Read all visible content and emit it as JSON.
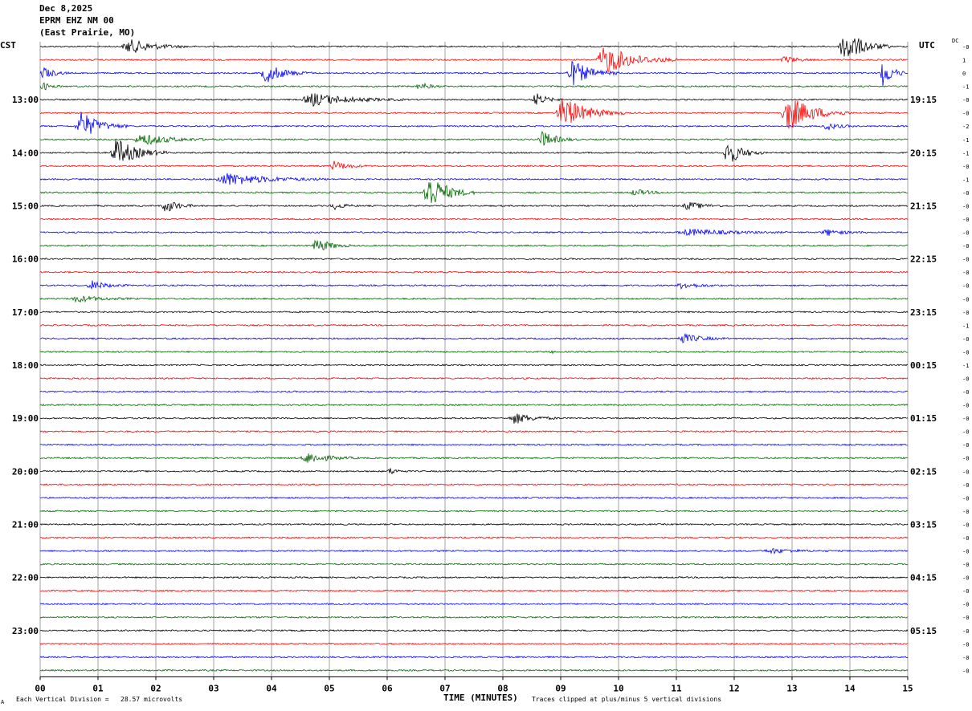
{
  "header": {
    "date": "Dec 8,2025",
    "station": "EPRM EHZ NM 00",
    "location": "(East Prairie, MO)"
  },
  "tz_left": "CST",
  "tz_right": "UTC",
  "dc_label": "DC",
  "footer": {
    "scale": "Each Vertical Division =   28.57 microvolts",
    "clip": "Traces clipped at plus/minus 5 vertical divisions",
    "mark": "A"
  },
  "chart_data": {
    "type": "line",
    "title": "EPRM EHZ NM 00",
    "xlabel": "TIME (MINUTES)",
    "ylabel": "",
    "xlim": [
      0,
      15
    ],
    "x_ticks": [
      "00",
      "01",
      "02",
      "03",
      "04",
      "05",
      "06",
      "07",
      "08",
      "09",
      "10",
      "11",
      "12",
      "13",
      "14",
      "15"
    ],
    "trace_count": 48,
    "trace_minutes": 15,
    "trace_colors": [
      "#000000",
      "#ff0000",
      "#0000ff",
      "#006600"
    ],
    "left_hour_labels": [
      "13:00",
      "14:00",
      "15:00",
      "16:00",
      "17:00",
      "18:00",
      "19:00",
      "20:00",
      "21:00",
      "22:00",
      "23:00"
    ],
    "right_hour_labels": [
      "19:15",
      "20:15",
      "21:15",
      "22:15",
      "23:15",
      "00:15",
      "01:15",
      "02:15",
      "03:15",
      "04:15",
      "05:15"
    ],
    "dc_offsets": [
      "-0",
      "1",
      "0",
      "-1",
      "-0",
      "-0",
      "-2",
      "-1",
      "-1",
      "-0",
      "-1",
      "-0",
      "-0",
      "-0",
      "-0",
      "-0",
      "-0",
      "-0",
      "-0",
      "-0",
      "-0",
      "-1",
      "-0",
      "-0",
      "-1",
      "-0",
      "-0",
      "-0",
      "-0",
      "-0",
      "-0",
      "-0",
      "-0",
      "-0",
      "-0",
      "-0",
      "-0",
      "-0",
      "-0",
      "-0",
      "-0",
      "-0",
      "-0",
      "-0",
      "-0",
      "-0",
      "-0",
      "-0"
    ],
    "events": [
      {
        "trace": 0,
        "minute": 1.4,
        "duration": 1.2,
        "amplitude": 9
      },
      {
        "trace": 0,
        "minute": 13.8,
        "duration": 0.9,
        "amplitude": 22
      },
      {
        "trace": 1,
        "minute": 9.6,
        "duration": 1.4,
        "amplitude": 18
      },
      {
        "trace": 1,
        "minute": 12.8,
        "duration": 0.6,
        "amplitude": 5
      },
      {
        "trace": 2,
        "minute": 0.0,
        "duration": 0.5,
        "amplitude": 8
      },
      {
        "trace": 2,
        "minute": 3.8,
        "duration": 0.9,
        "amplitude": 12
      },
      {
        "trace": 2,
        "minute": 9.1,
        "duration": 0.9,
        "amplitude": 16
      },
      {
        "trace": 2,
        "minute": 14.5,
        "duration": 0.5,
        "amplitude": 18
      },
      {
        "trace": 3,
        "minute": 0.0,
        "duration": 0.4,
        "amplitude": 5
      },
      {
        "trace": 3,
        "minute": 6.5,
        "duration": 0.5,
        "amplitude": 5
      },
      {
        "trace": 4,
        "minute": 4.5,
        "duration": 1.8,
        "amplitude": 8
      },
      {
        "trace": 4,
        "minute": 8.5,
        "duration": 0.5,
        "amplitude": 9
      },
      {
        "trace": 5,
        "minute": 8.9,
        "duration": 1.2,
        "amplitude": 20
      },
      {
        "trace": 5,
        "minute": 12.8,
        "duration": 1.2,
        "amplitude": 22
      },
      {
        "trace": 6,
        "minute": 0.6,
        "duration": 0.9,
        "amplitude": 18
      },
      {
        "trace": 6,
        "minute": 13.5,
        "duration": 0.6,
        "amplitude": 5
      },
      {
        "trace": 7,
        "minute": 1.6,
        "duration": 1.4,
        "amplitude": 7
      },
      {
        "trace": 7,
        "minute": 8.6,
        "duration": 0.7,
        "amplitude": 10
      },
      {
        "trace": 8,
        "minute": 1.2,
        "duration": 1.0,
        "amplitude": 18
      },
      {
        "trace": 8,
        "minute": 11.8,
        "duration": 0.7,
        "amplitude": 16
      },
      {
        "trace": 9,
        "minute": 5.0,
        "duration": 0.7,
        "amplitude": 6
      },
      {
        "trace": 10,
        "minute": 3.0,
        "duration": 2.0,
        "amplitude": 8
      },
      {
        "trace": 11,
        "minute": 6.6,
        "duration": 0.9,
        "amplitude": 24
      },
      {
        "trace": 11,
        "minute": 10.2,
        "duration": 0.7,
        "amplitude": 4
      },
      {
        "trace": 12,
        "minute": 2.1,
        "duration": 0.6,
        "amplitude": 9
      },
      {
        "trace": 12,
        "minute": 5.0,
        "duration": 0.5,
        "amplitude": 5
      },
      {
        "trace": 12,
        "minute": 11.1,
        "duration": 0.8,
        "amplitude": 5
      },
      {
        "trace": 14,
        "minute": 11.0,
        "duration": 2.0,
        "amplitude": 4
      },
      {
        "trace": 14,
        "minute": 13.5,
        "duration": 0.8,
        "amplitude": 4
      },
      {
        "trace": 15,
        "minute": 4.7,
        "duration": 0.7,
        "amplitude": 9
      },
      {
        "trace": 18,
        "minute": 0.8,
        "duration": 0.7,
        "amplitude": 6
      },
      {
        "trace": 18,
        "minute": 11.0,
        "duration": 0.8,
        "amplitude": 4
      },
      {
        "trace": 19,
        "minute": 0.5,
        "duration": 1.2,
        "amplitude": 4
      },
      {
        "trace": 22,
        "minute": 11.0,
        "duration": 0.9,
        "amplitude": 6
      },
      {
        "trace": 23,
        "minute": 8.8,
        "duration": 0.1,
        "amplitude": 5
      },
      {
        "trace": 28,
        "minute": 8.1,
        "duration": 0.9,
        "amplitude": 7
      },
      {
        "trace": 31,
        "minute": 4.5,
        "duration": 1.0,
        "amplitude": 7
      },
      {
        "trace": 32,
        "minute": 6.0,
        "duration": 0.4,
        "amplitude": 4
      },
      {
        "trace": 38,
        "minute": 12.5,
        "duration": 1.2,
        "amplitude": 3
      }
    ]
  }
}
